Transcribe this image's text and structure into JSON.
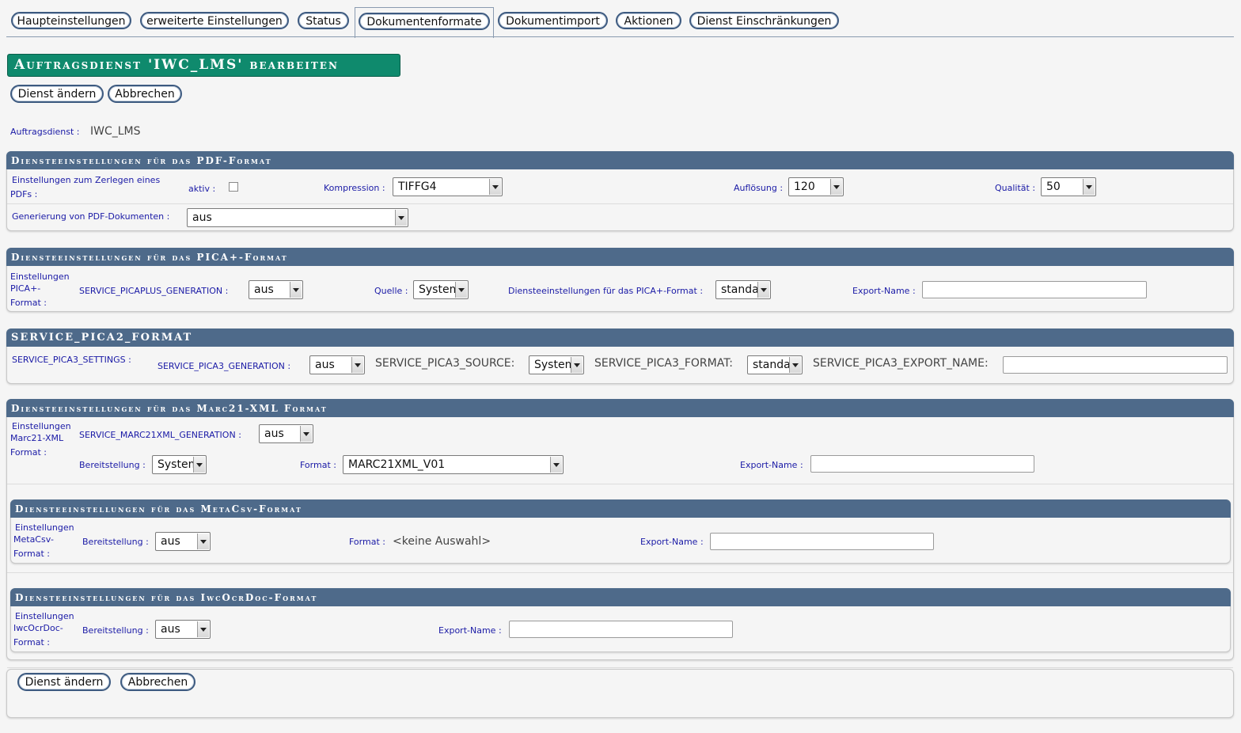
{
  "tabs": [
    "Haupteinstellungen",
    "erweiterte Einstellungen",
    "Status",
    "Dokumentenformate",
    "Dokumentimport",
    "Aktionen",
    "Dienst Einschränkungen"
  ],
  "title": "Auftragsdienst 'IWC_LMS' bearbeiten",
  "buttons": {
    "change": "Dienst ändern",
    "cancel": "Abbrechen"
  },
  "service": {
    "label": "Auftragsdienst",
    "value": "IWC_LMS"
  },
  "colon": ":",
  "pdf": {
    "header": "Diensteeinstellungen für das PDF-Format",
    "split_label_line1": "Einstellungen zum Zerlegen eines",
    "split_label_line2": "PDFs",
    "aktiv_label": "aktiv",
    "aktiv_checked": false,
    "kompression_label": "Kompression",
    "kompression_value": "TIFFG4",
    "aufloesung_label": "Auflösung",
    "aufloesung_value": "120",
    "qualitaet_label": "Qualität",
    "qualitaet_value": "50",
    "generation_label": "Generierung von PDF-Dokumenten",
    "generation_value": "aus"
  },
  "pica": {
    "header": "Diensteeinstellungen für das PICA+-Format",
    "group_line1": "Einstellungen",
    "group_line2": "PICA+-",
    "group_line3": "Format",
    "generation_label": "SERVICE_PICAPLUS_GENERATION",
    "generation_value": "aus",
    "quelle_label": "Quelle",
    "quelle_value": "System",
    "format_label": "Diensteeinstellungen für das PICA+-Format",
    "format_value": "standard",
    "export_label": "Export-Name",
    "export_value": ""
  },
  "pica3": {
    "header": "SERVICE_PICA2_FORMAT",
    "settings_label": "SERVICE_PICA3_SETTINGS",
    "generation_label": "SERVICE_PICA3_GENERATION",
    "generation_value": "aus",
    "source_label": "SERVICE_PICA3_SOURCE:",
    "source_value": "System",
    "format_label": "SERVICE_PICA3_FORMAT:",
    "format_value": "standard",
    "export_label": "SERVICE_PICA3_EXPORT_NAME:",
    "export_value": ""
  },
  "marc": {
    "header": "Diensteeinstellungen für das Marc21-XML Format",
    "group_line1": "Einstellungen",
    "group_line2": "Marc21-XML",
    "group_line3": "Format",
    "generation_label": "SERVICE_MARC21XML_GENERATION",
    "generation_value": "aus",
    "bereit_label": "Bereitstellung",
    "bereit_value": "System",
    "format_label": "Format",
    "format_value": "MARC21XML_V01",
    "export_label": "Export-Name",
    "export_value": ""
  },
  "metacsv": {
    "header": "Diensteeinstellungen für das MetaCsv-Format",
    "group_line1": "Einstellungen",
    "group_line2": "MetaCsv-",
    "group_line3": "Format",
    "bereit_label": "Bereitstellung",
    "bereit_value": "aus",
    "format_label": "Format",
    "format_value": "<keine Auswahl>",
    "export_label": "Export-Name",
    "export_value": ""
  },
  "iwcocr": {
    "header": "Diensteeinstellungen für das IwcOcrDoc-Format",
    "group_line1": "Einstellungen",
    "group_line2": "IwcOcrDoc-",
    "group_line3": "Format",
    "bereit_label": "Bereitstellung",
    "bereit_value": "aus",
    "export_label": "Export-Name",
    "export_value": ""
  }
}
